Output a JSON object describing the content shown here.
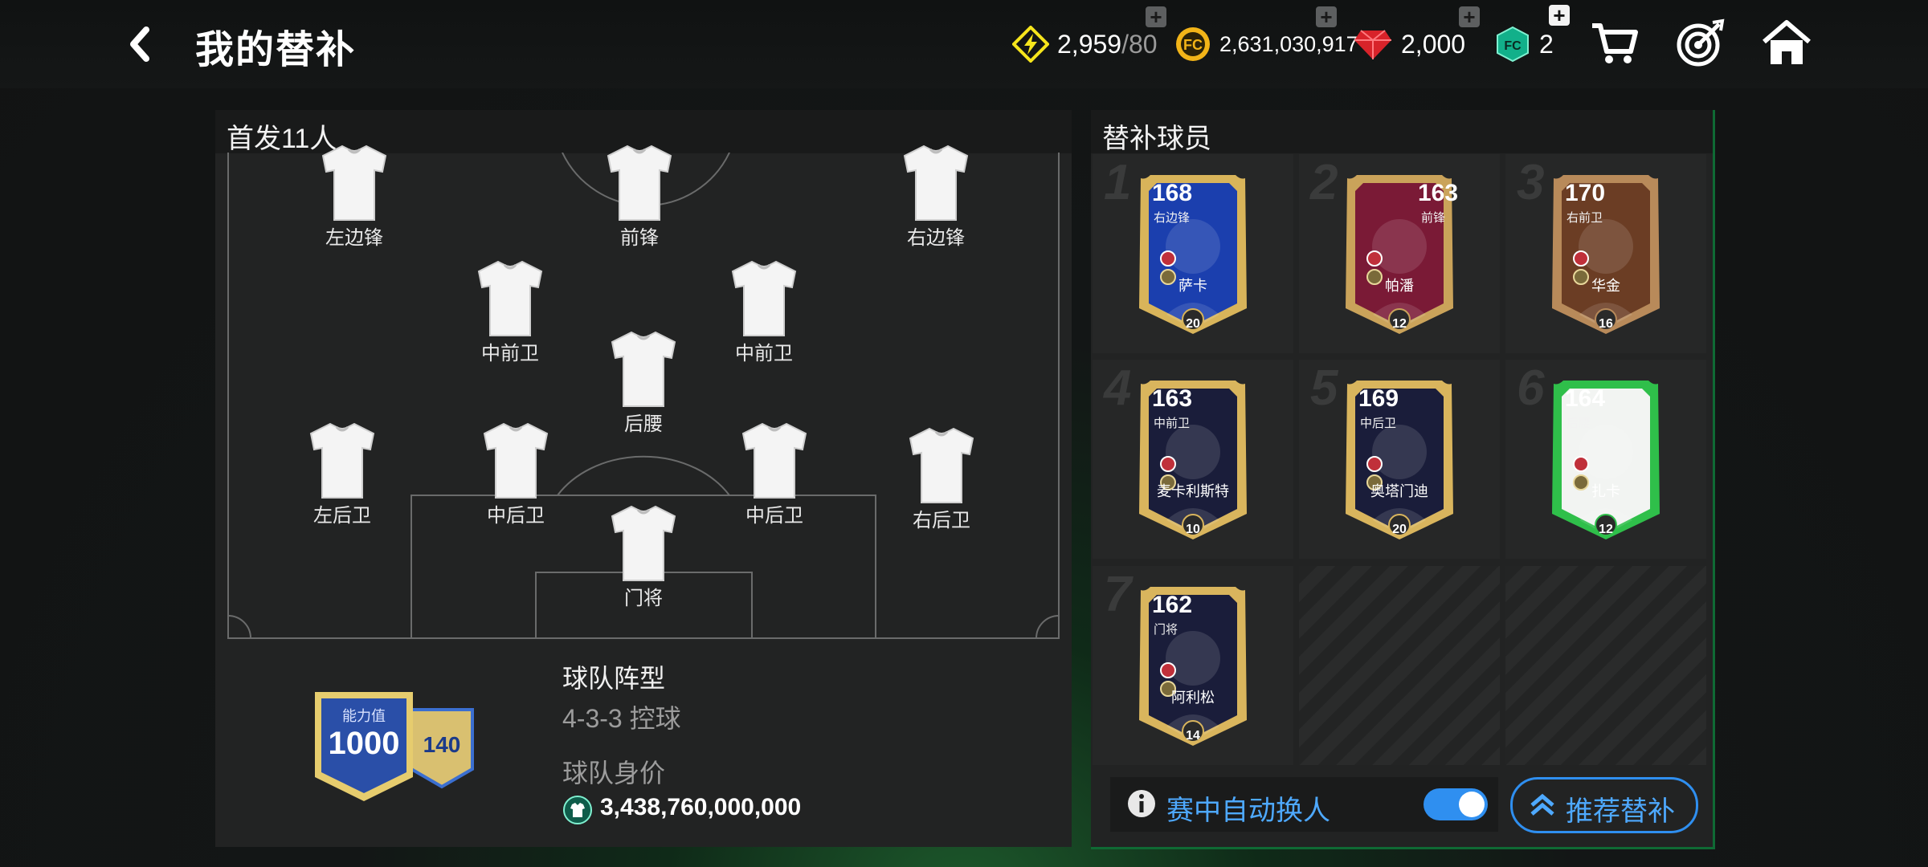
{
  "header": {
    "title": "我的替补",
    "energy": {
      "current": "2,959",
      "max": "/80"
    },
    "coins": "2,631,030,917",
    "gems": "2,000",
    "tokens": "2"
  },
  "starting": {
    "title": "首发11人",
    "positions": [
      "左边锋",
      "前锋",
      "右边锋",
      "中前卫",
      "中前卫",
      "后腰",
      "左后卫",
      "中后卫",
      "中后卫",
      "右后卫",
      "门将"
    ]
  },
  "team": {
    "rating_label": "能力值",
    "rating": "1000",
    "bonus": "140",
    "formation_title": "球队阵型",
    "formation": "4-3-3 控球",
    "value_title": "球队身价",
    "value": "3,438,760,000,000"
  },
  "subs": {
    "title": "替补球员",
    "players": [
      {
        "slot": "1",
        "rating": "168",
        "position": "右边锋",
        "name": "萨卡",
        "level": "20",
        "style": "toty"
      },
      {
        "slot": "2",
        "rating": "163",
        "position": "前锋",
        "name": "帕潘",
        "level": "12",
        "style": "icon"
      },
      {
        "slot": "3",
        "rating": "170",
        "position": "右前卫",
        "name": "华金",
        "level": "16",
        "style": "bronze"
      },
      {
        "slot": "4",
        "rating": "163",
        "position": "中前卫",
        "name": "麦卡利斯特",
        "level": "10",
        "style": "gold"
      },
      {
        "slot": "5",
        "rating": "169",
        "position": "中后卫",
        "name": "奥塔门迪",
        "level": "20",
        "style": "gold"
      },
      {
        "slot": "6",
        "rating": "164",
        "position": "后腰",
        "name": "扎卡",
        "level": "12",
        "style": "green"
      },
      {
        "slot": "7",
        "rating": "162",
        "position": "门将",
        "name": "阿利松",
        "level": "14",
        "style": "gold"
      }
    ],
    "auto_sub_label": "赛中自动换人",
    "auto_sub_enabled": true,
    "recommend_label": "推荐替补"
  }
}
